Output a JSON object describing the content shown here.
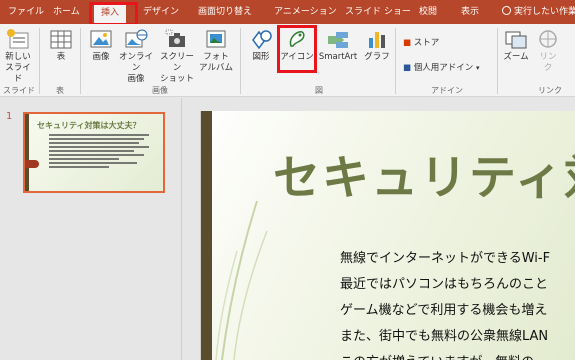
{
  "tabs": [
    "ファイル",
    "ホーム",
    "挿入",
    "デザイン",
    "画面切り替え",
    "アニメーション",
    "スライド ショー",
    "校閲",
    "表示",
    "実行したい作業"
  ],
  "ribbon": {
    "new_slide": [
      "新しい",
      "スライド"
    ],
    "table": "表",
    "image": "画像",
    "online_image": [
      "オンライン",
      "画像"
    ],
    "screenshot": [
      "スクリーン",
      "ショット"
    ],
    "photo_album": [
      "フォト",
      "アルバム"
    ],
    "shape": "図形",
    "icon": "アイコン",
    "smartart": "SmartArt",
    "graph": "グラフ",
    "store": "ストア",
    "personal_addin": "個人用アドイン",
    "zoom": "ズーム",
    "link": [
      "リン",
      "ク"
    ],
    "groups": [
      "スライド",
      "表",
      "画像",
      "図",
      "アドイン",
      "リンク"
    ]
  },
  "slides_pane": {
    "number": "1",
    "thumb_title": "セキュリティ対策は大丈夫？"
  },
  "slide": {
    "title": "セキュリティ対",
    "body": [
      "無線でインターネットができるWi-F",
      "最近ではパソコンはもちろんのこと",
      "ゲーム機などで利用する機会も増え",
      "また、街中でも無料の公衆無線LAN",
      "この方が増えていますが、無料の"
    ]
  },
  "colors": {
    "accent": "#b7472a",
    "highlight": "#e8151c",
    "title_green": "#6e7a45"
  }
}
